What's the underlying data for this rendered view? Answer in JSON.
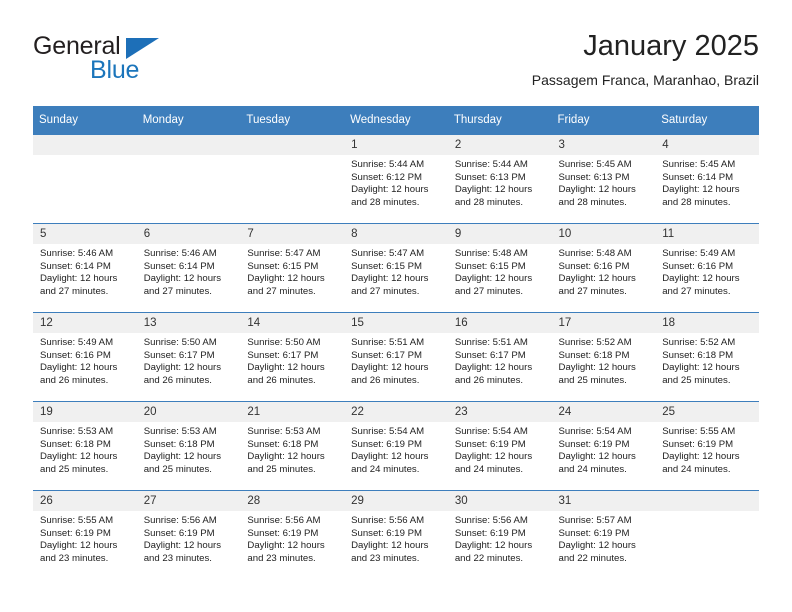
{
  "brand": {
    "name_top": "General",
    "name_bottom": "Blue",
    "triangle_icon": "blue-triangle-icon",
    "color_dark": "#231f20",
    "color_blue": "#1b75bb"
  },
  "header": {
    "title": "January 2025",
    "subtitle": "Passagem Franca, Maranhao, Brazil"
  },
  "theme": {
    "header_blue": "#3d7ebc",
    "daynum_band": "#f0f0f0",
    "text": "#222222"
  },
  "calendar": {
    "weekdays": [
      "Sunday",
      "Monday",
      "Tuesday",
      "Wednesday",
      "Thursday",
      "Friday",
      "Saturday"
    ],
    "weeks": [
      [
        {
          "day": "",
          "empty": true
        },
        {
          "day": "",
          "empty": true
        },
        {
          "day": "",
          "empty": true
        },
        {
          "day": "1",
          "sunrise": "Sunrise: 5:44 AM",
          "sunset": "Sunset: 6:12 PM",
          "daylight1": "Daylight: 12 hours",
          "daylight2": "and 28 minutes."
        },
        {
          "day": "2",
          "sunrise": "Sunrise: 5:44 AM",
          "sunset": "Sunset: 6:13 PM",
          "daylight1": "Daylight: 12 hours",
          "daylight2": "and 28 minutes."
        },
        {
          "day": "3",
          "sunrise": "Sunrise: 5:45 AM",
          "sunset": "Sunset: 6:13 PM",
          "daylight1": "Daylight: 12 hours",
          "daylight2": "and 28 minutes."
        },
        {
          "day": "4",
          "sunrise": "Sunrise: 5:45 AM",
          "sunset": "Sunset: 6:14 PM",
          "daylight1": "Daylight: 12 hours",
          "daylight2": "and 28 minutes."
        }
      ],
      [
        {
          "day": "5",
          "sunrise": "Sunrise: 5:46 AM",
          "sunset": "Sunset: 6:14 PM",
          "daylight1": "Daylight: 12 hours",
          "daylight2": "and 27 minutes."
        },
        {
          "day": "6",
          "sunrise": "Sunrise: 5:46 AM",
          "sunset": "Sunset: 6:14 PM",
          "daylight1": "Daylight: 12 hours",
          "daylight2": "and 27 minutes."
        },
        {
          "day": "7",
          "sunrise": "Sunrise: 5:47 AM",
          "sunset": "Sunset: 6:15 PM",
          "daylight1": "Daylight: 12 hours",
          "daylight2": "and 27 minutes."
        },
        {
          "day": "8",
          "sunrise": "Sunrise: 5:47 AM",
          "sunset": "Sunset: 6:15 PM",
          "daylight1": "Daylight: 12 hours",
          "daylight2": "and 27 minutes."
        },
        {
          "day": "9",
          "sunrise": "Sunrise: 5:48 AM",
          "sunset": "Sunset: 6:15 PM",
          "daylight1": "Daylight: 12 hours",
          "daylight2": "and 27 minutes."
        },
        {
          "day": "10",
          "sunrise": "Sunrise: 5:48 AM",
          "sunset": "Sunset: 6:16 PM",
          "daylight1": "Daylight: 12 hours",
          "daylight2": "and 27 minutes."
        },
        {
          "day": "11",
          "sunrise": "Sunrise: 5:49 AM",
          "sunset": "Sunset: 6:16 PM",
          "daylight1": "Daylight: 12 hours",
          "daylight2": "and 27 minutes."
        }
      ],
      [
        {
          "day": "12",
          "sunrise": "Sunrise: 5:49 AM",
          "sunset": "Sunset: 6:16 PM",
          "daylight1": "Daylight: 12 hours",
          "daylight2": "and 26 minutes."
        },
        {
          "day": "13",
          "sunrise": "Sunrise: 5:50 AM",
          "sunset": "Sunset: 6:17 PM",
          "daylight1": "Daylight: 12 hours",
          "daylight2": "and 26 minutes."
        },
        {
          "day": "14",
          "sunrise": "Sunrise: 5:50 AM",
          "sunset": "Sunset: 6:17 PM",
          "daylight1": "Daylight: 12 hours",
          "daylight2": "and 26 minutes."
        },
        {
          "day": "15",
          "sunrise": "Sunrise: 5:51 AM",
          "sunset": "Sunset: 6:17 PM",
          "daylight1": "Daylight: 12 hours",
          "daylight2": "and 26 minutes."
        },
        {
          "day": "16",
          "sunrise": "Sunrise: 5:51 AM",
          "sunset": "Sunset: 6:17 PM",
          "daylight1": "Daylight: 12 hours",
          "daylight2": "and 26 minutes."
        },
        {
          "day": "17",
          "sunrise": "Sunrise: 5:52 AM",
          "sunset": "Sunset: 6:18 PM",
          "daylight1": "Daylight: 12 hours",
          "daylight2": "and 25 minutes."
        },
        {
          "day": "18",
          "sunrise": "Sunrise: 5:52 AM",
          "sunset": "Sunset: 6:18 PM",
          "daylight1": "Daylight: 12 hours",
          "daylight2": "and 25 minutes."
        }
      ],
      [
        {
          "day": "19",
          "sunrise": "Sunrise: 5:53 AM",
          "sunset": "Sunset: 6:18 PM",
          "daylight1": "Daylight: 12 hours",
          "daylight2": "and 25 minutes."
        },
        {
          "day": "20",
          "sunrise": "Sunrise: 5:53 AM",
          "sunset": "Sunset: 6:18 PM",
          "daylight1": "Daylight: 12 hours",
          "daylight2": "and 25 minutes."
        },
        {
          "day": "21",
          "sunrise": "Sunrise: 5:53 AM",
          "sunset": "Sunset: 6:18 PM",
          "daylight1": "Daylight: 12 hours",
          "daylight2": "and 25 minutes."
        },
        {
          "day": "22",
          "sunrise": "Sunrise: 5:54 AM",
          "sunset": "Sunset: 6:19 PM",
          "daylight1": "Daylight: 12 hours",
          "daylight2": "and 24 minutes."
        },
        {
          "day": "23",
          "sunrise": "Sunrise: 5:54 AM",
          "sunset": "Sunset: 6:19 PM",
          "daylight1": "Daylight: 12 hours",
          "daylight2": "and 24 minutes."
        },
        {
          "day": "24",
          "sunrise": "Sunrise: 5:54 AM",
          "sunset": "Sunset: 6:19 PM",
          "daylight1": "Daylight: 12 hours",
          "daylight2": "and 24 minutes."
        },
        {
          "day": "25",
          "sunrise": "Sunrise: 5:55 AM",
          "sunset": "Sunset: 6:19 PM",
          "daylight1": "Daylight: 12 hours",
          "daylight2": "and 24 minutes."
        }
      ],
      [
        {
          "day": "26",
          "sunrise": "Sunrise: 5:55 AM",
          "sunset": "Sunset: 6:19 PM",
          "daylight1": "Daylight: 12 hours",
          "daylight2": "and 23 minutes."
        },
        {
          "day": "27",
          "sunrise": "Sunrise: 5:56 AM",
          "sunset": "Sunset: 6:19 PM",
          "daylight1": "Daylight: 12 hours",
          "daylight2": "and 23 minutes."
        },
        {
          "day": "28",
          "sunrise": "Sunrise: 5:56 AM",
          "sunset": "Sunset: 6:19 PM",
          "daylight1": "Daylight: 12 hours",
          "daylight2": "and 23 minutes."
        },
        {
          "day": "29",
          "sunrise": "Sunrise: 5:56 AM",
          "sunset": "Sunset: 6:19 PM",
          "daylight1": "Daylight: 12 hours",
          "daylight2": "and 23 minutes."
        },
        {
          "day": "30",
          "sunrise": "Sunrise: 5:56 AM",
          "sunset": "Sunset: 6:19 PM",
          "daylight1": "Daylight: 12 hours",
          "daylight2": "and 22 minutes."
        },
        {
          "day": "31",
          "sunrise": "Sunrise: 5:57 AM",
          "sunset": "Sunset: 6:19 PM",
          "daylight1": "Daylight: 12 hours",
          "daylight2": "and 22 minutes."
        },
        {
          "day": "",
          "empty": true
        }
      ]
    ]
  }
}
